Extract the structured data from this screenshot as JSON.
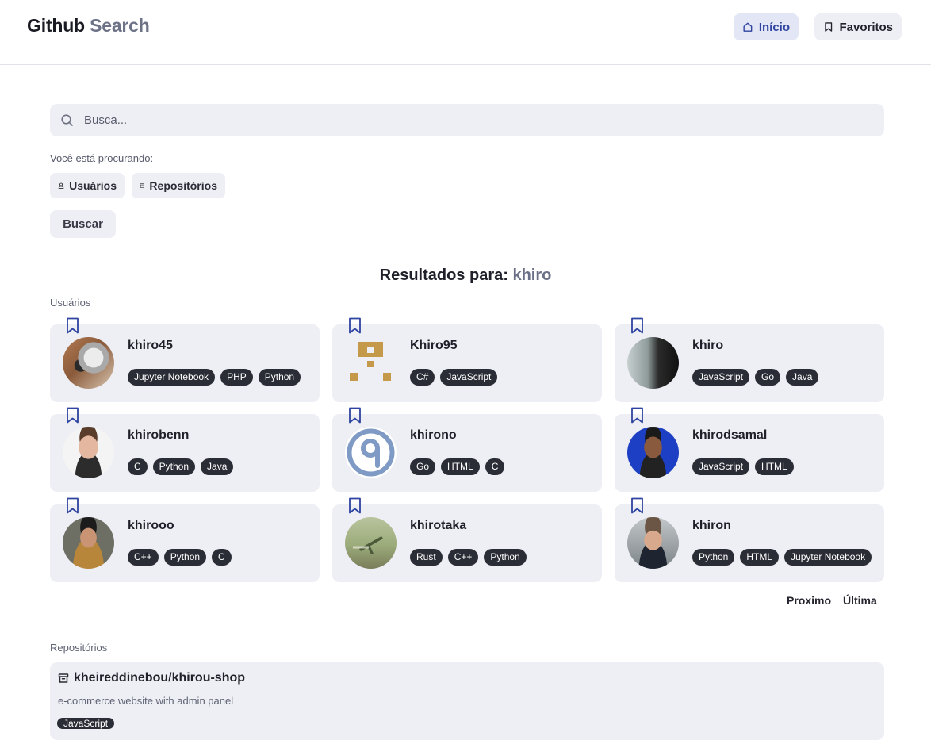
{
  "header": {
    "logo_primary": "Github",
    "logo_secondary": "Search",
    "nav_home_label": "Início",
    "nav_favorites_label": "Favoritos"
  },
  "search": {
    "placeholder": "Busca...",
    "value": ""
  },
  "filters": {
    "prompt": "Você está procurando:",
    "users_label": "Usuários",
    "repos_label": "Repositórios"
  },
  "search_button": "Buscar",
  "results": {
    "prefix": "Resultados para:",
    "query": "khiro"
  },
  "users_section_label": "Usuários",
  "users": [
    {
      "name": "khiro45",
      "tags": [
        "Jupyter Notebook",
        "PHP",
        "Python"
      ]
    },
    {
      "name": "Khiro95",
      "tags": [
        "C#",
        "JavaScript"
      ]
    },
    {
      "name": "khiro",
      "tags": [
        "JavaScript",
        "Go",
        "Java"
      ]
    },
    {
      "name": "khirobenn",
      "tags": [
        "C",
        "Python",
        "Java"
      ]
    },
    {
      "name": "khirono",
      "tags": [
        "Go",
        "HTML",
        "C"
      ]
    },
    {
      "name": "khirodsamal",
      "tags": [
        "JavaScript",
        "HTML"
      ]
    },
    {
      "name": "khirooo",
      "tags": [
        "C++",
        "Python",
        "C"
      ]
    },
    {
      "name": "khirotaka",
      "tags": [
        "Rust",
        "C++",
        "Python"
      ]
    },
    {
      "name": "khiron",
      "tags": [
        "Python",
        "HTML",
        "Jupyter Notebook"
      ]
    }
  ],
  "pagination": {
    "next_label": "Proximo",
    "last_label": "Última"
  },
  "repos_section_label": "Repositórios",
  "repos": [
    {
      "full_name": "kheireddinebou/khirou-shop",
      "description": "e-commerce website with admin panel",
      "tags": [
        "JavaScript"
      ]
    }
  ],
  "colors": {
    "accent": "#2f43a0",
    "card_bg": "#eeeff4",
    "tag_bg": "#2b2d36",
    "muted_text": "#6b7086"
  }
}
